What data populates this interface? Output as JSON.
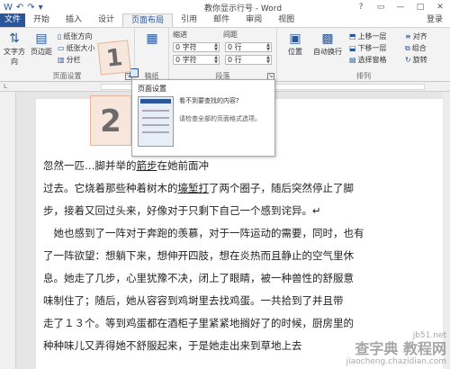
{
  "window": {
    "title": "教你显示行号 - Word",
    "controls": [
      "?",
      "▭",
      "—",
      "□",
      "✕"
    ]
  },
  "qat": [
    "undo-icon",
    "redo-icon",
    "save-icon"
  ],
  "tabs": [
    {
      "label": "文件",
      "active": false
    },
    {
      "label": "开始",
      "active": false
    },
    {
      "label": "插入",
      "active": false
    },
    {
      "label": "设计",
      "active": false
    },
    {
      "label": "页面布局",
      "active": true
    },
    {
      "label": "引用",
      "active": false
    },
    {
      "label": "邮件",
      "active": false
    },
    {
      "label": "审阅",
      "active": false
    },
    {
      "label": "视图",
      "active": false
    }
  ],
  "login": "登录",
  "ribbon": {
    "page_setup": {
      "text_direction": "文字方向",
      "margins": "页边距",
      "orientation": "纸张方向",
      "size": "纸张大小",
      "columns": "分栏",
      "group_label": "页面设置"
    },
    "paper": {
      "label": "稿纸"
    },
    "paragraph": {
      "indent_label": "缩进",
      "spacing_label": "间距",
      "indent_left": "0 字符",
      "indent_right": "0 字符",
      "spacing_before": "0 行",
      "spacing_after": "0 行",
      "group_label": "段落"
    },
    "arrange": {
      "position": "位置",
      "wrap": "自动换行",
      "bring_forward": "上移一层",
      "send_backward": "下移一层",
      "selection_pane": "选择窗格",
      "align": "对齐",
      "group": "组合",
      "rotate": "旋转",
      "group_label": "排列"
    }
  },
  "annotations": {
    "step1": "1",
    "step2": "2"
  },
  "tooltip": {
    "title": "页面设置",
    "question": "看不到要查找的内容?",
    "description": "请检查全部的页面格式选项。"
  },
  "document": {
    "paragraphs": [
      {
        "lines": [
          [
            {
              "t": "忽然一匹"
            },
            {
              "t": "…",
              "s": ""
            },
            {
              "t": "脚并举的"
            },
            {
              "t": "箭步",
              "s": "u"
            },
            {
              "t": "在",
              "s": ""
            },
            {
              "t": "她前面冲"
            }
          ],
          [
            {
              "t": "过去。它烧着那些种着树木的"
            },
            {
              "t": "壕堑打",
              "s": "u"
            },
            {
              "t": "了两个圈子，随后突然停止了脚"
            }
          ],
          [
            {
              "t": "步，接着又回过头来，好像对于只剩下自己一个感到诧异。↵"
            }
          ]
        ]
      },
      {
        "lines": [
          [
            {
              "t": "　她也感到了一阵对于奔跑的羡慕，对于一阵运动的需要，同时，也有"
            }
          ],
          [
            {
              "t": "了一阵欲望：想躺下来，想伸开四肢，想在炎热而且静止的空气里休"
            }
          ],
          [
            {
              "t": "息。她走了几步，心里犹豫不决，闭上了眼睛，被一种兽性的舒服意"
            }
          ],
          [
            {
              "t": "味制住了；随后，她从容容到鸡埘里去找鸡蛋。一共拾到了并且带"
            }
          ],
          [
            {
              "t": "走了１３个。等到鸡蛋都在酒柜子里紧紧地搁好了的时候，厨房里的"
            }
          ],
          [
            {
              "t": "种种味儿又弄得她不舒服起来，于是她走出来到草地上去"
            }
          ]
        ]
      }
    ]
  },
  "watermark": {
    "line1": "查字典 教程网",
    "line2": "jiaocheng.chazidian.com",
    "site": "jb51.net"
  }
}
